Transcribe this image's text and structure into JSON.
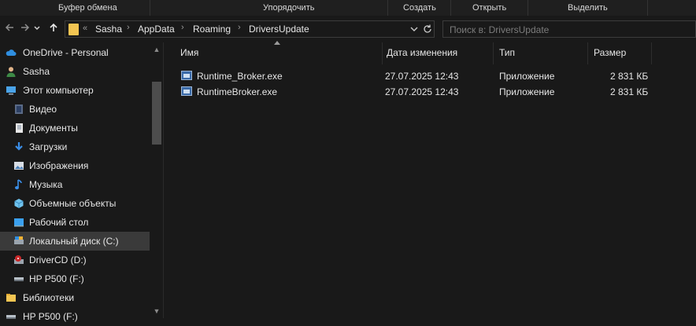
{
  "ribbon": {
    "groups": [
      "Буфер обмена",
      "Упорядочить",
      "Создать",
      "Открыть",
      "Выделить"
    ]
  },
  "nav": {
    "back_icon": "arrow-left-icon",
    "forward_icon": "arrow-right-icon",
    "recent_icon": "chevron-down-icon",
    "up_icon": "arrow-up-icon"
  },
  "address": {
    "overflow": "«",
    "crumbs": [
      "Sasha",
      "AppData",
      "Roaming",
      "DriversUpdate"
    ],
    "dropdown_icon": "chevron-down-icon",
    "refresh_icon": "refresh-icon"
  },
  "search": {
    "placeholder": "Поиск в: DriversUpdate"
  },
  "sidebar": {
    "items": [
      {
        "label": "OneDrive - Personal",
        "icon": "cloud-icon"
      },
      {
        "label": "Sasha",
        "icon": "user-icon"
      },
      {
        "label": "Этот компьютер",
        "icon": "computer-icon"
      },
      {
        "label": "Видео",
        "icon": "video-icon"
      },
      {
        "label": "Документы",
        "icon": "document-icon"
      },
      {
        "label": "Загрузки",
        "icon": "download-icon"
      },
      {
        "label": "Изображения",
        "icon": "image-icon"
      },
      {
        "label": "Музыка",
        "icon": "music-icon"
      },
      {
        "label": "Объемные объекты",
        "icon": "cube-icon"
      },
      {
        "label": "Рабочий стол",
        "icon": "desktop-icon"
      },
      {
        "label": "Локальный диск (C:)",
        "icon": "drive-icon"
      },
      {
        "label": "DriverCD (D:)",
        "icon": "cd-drive-icon"
      },
      {
        "label": "HP P500 (F:)",
        "icon": "usb-drive-icon"
      },
      {
        "label": "Библиотеки",
        "icon": "library-icon"
      },
      {
        "label": "HP P500 (F:)",
        "icon": "usb-drive-icon"
      }
    ]
  },
  "columns": {
    "name": "Имя",
    "date": "Дата изменения",
    "type": "Тип",
    "size": "Размер"
  },
  "files": [
    {
      "name": "Runtime_Broker.exe",
      "date": "27.07.2025 12:43",
      "type": "Приложение",
      "size": "2 831 КБ"
    },
    {
      "name": "RuntimeBroker.exe",
      "date": "27.07.2025 12:43",
      "type": "Приложение",
      "size": "2 831 КБ"
    }
  ],
  "colors": {
    "background": "#191919",
    "selected": "#3a3a3a",
    "folder": "#f3c552",
    "text": "#e6e6e6"
  }
}
